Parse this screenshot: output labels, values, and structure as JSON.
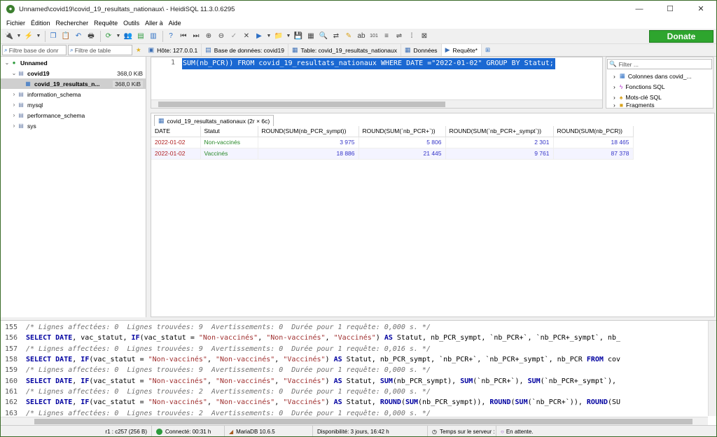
{
  "window": {
    "title": "Unnamed\\covid19\\covid_19_resultats_nationaux\\ - HeidiSQL 11.3.0.6295",
    "minimize": "—",
    "maximize": "☐",
    "close": "✕"
  },
  "menu": [
    "Fichier",
    "Édition",
    "Rechercher",
    "Requête",
    "Outils",
    "Aller à",
    "Aide"
  ],
  "toolbar": {
    "donate_label": "Donate"
  },
  "filters": {
    "db_placeholder": "Filtre base de donr",
    "table_placeholder": "Filtre de table"
  },
  "tabs": [
    {
      "label": "Hôte: 127.0.0.1"
    },
    {
      "label": "Base de données: covid19"
    },
    {
      "label": "Table: covid_19_resultats_nationaux"
    },
    {
      "label": "Données"
    },
    {
      "label": "Requête*"
    }
  ],
  "tree": {
    "root": "Unnamed",
    "db": {
      "name": "covid19",
      "size": "368,0 KiB"
    },
    "table": {
      "name": "covid_19_resultats_n...",
      "size": "368,0 KiB"
    },
    "others": [
      "information_schema",
      "mysql",
      "performance_schema",
      "sys"
    ]
  },
  "editor": {
    "line_number": "1",
    "sql": "SUM(nb_PCR)) FROM covid_19_resultats_nationaux WHERE DATE =\"2022-01-02\" GROUP BY Statut;"
  },
  "helpers": {
    "filter_placeholder": "Filter ...",
    "items": [
      "Colonnes dans covid_...",
      "Fonctions SQL",
      "Mots-clé SQL",
      "Fragments"
    ]
  },
  "results": {
    "tab_label": "covid_19_resultats_nationaux (2r × 6c)",
    "columns": [
      "DATE",
      "Statut",
      "ROUND(SUM(nb_PCR_sympt))",
      "ROUND(SUM(`nb_PCR+`))",
      "ROUND(SUM(`nb_PCR+_sympt`))",
      "ROUND(SUM(nb_PCR))"
    ],
    "rows": [
      [
        "2022-01-02",
        "Non-vaccinés",
        "3 975",
        "5 806",
        "2 301",
        "18 465"
      ],
      [
        "2022-01-02",
        "Vaccinés",
        "18 886",
        "21 445",
        "9 761",
        "87 378"
      ]
    ]
  },
  "log": [
    {
      "n": "155",
      "type": "comment",
      "text": "/* Lignes affectées: 0  Lignes trouvées: 9  Avertissements: 0  Durée pour 1 requête: 0,000 s. */"
    },
    {
      "n": "156",
      "type": "sql",
      "text": "SELECT DATE, vac_statut, IF(vac_statut = \"Non-vaccinés\", \"Non-vaccinés\", \"Vaccinés\") AS Statut, nb_PCR_sympt, `nb_PCR+`, `nb_PCR+_sympt`, nb_"
    },
    {
      "n": "157",
      "type": "comment",
      "text": "/* Lignes affectées: 0  Lignes trouvées: 9  Avertissements: 0  Durée pour 1 requête: 0,016 s. */"
    },
    {
      "n": "158",
      "type": "sql",
      "text": "SELECT DATE, IF(vac_statut = \"Non-vaccinés\", \"Non-vaccinés\", \"Vaccinés\") AS Statut, nb_PCR_sympt, `nb_PCR+`, `nb_PCR+_sympt`, nb_PCR FROM cov"
    },
    {
      "n": "159",
      "type": "comment",
      "text": "/* Lignes affectées: 0  Lignes trouvées: 9  Avertissements: 0  Durée pour 1 requête: 0,000 s. */"
    },
    {
      "n": "160",
      "type": "sql",
      "text": "SELECT DATE, IF(vac_statut = \"Non-vaccinés\", \"Non-vaccinés\", \"Vaccinés\") AS Statut, SUM(nb_PCR_sympt), SUM(`nb_PCR+`), SUM(`nb_PCR+_sympt`),"
    },
    {
      "n": "161",
      "type": "comment",
      "text": "/* Lignes affectées: 0  Lignes trouvées: 2  Avertissements: 0  Durée pour 1 requête: 0,000 s. */"
    },
    {
      "n": "162",
      "type": "sql",
      "text": "SELECT DATE, IF(vac_statut = \"Non-vaccinés\", \"Non-vaccinés\", \"Vaccinés\") AS Statut, ROUND(SUM(nb_PCR_sympt)), ROUND(SUM(`nb_PCR+`)), ROUND(SU"
    },
    {
      "n": "163",
      "type": "comment",
      "text": "/* Lignes affectées: 0  Lignes trouvées: 2  Avertissements: 0  Durée pour 1 requête: 0,000 s. */"
    }
  ],
  "status": {
    "position": "r1 : c257 (256 B)",
    "connected": "Connecté: 00:31 h",
    "server": "MariaDB 10.6.5",
    "uptime": "Disponibilité: 3 jours, 16:42 h",
    "server_time": "Temps sur le serveur :",
    "state": "En attente."
  }
}
